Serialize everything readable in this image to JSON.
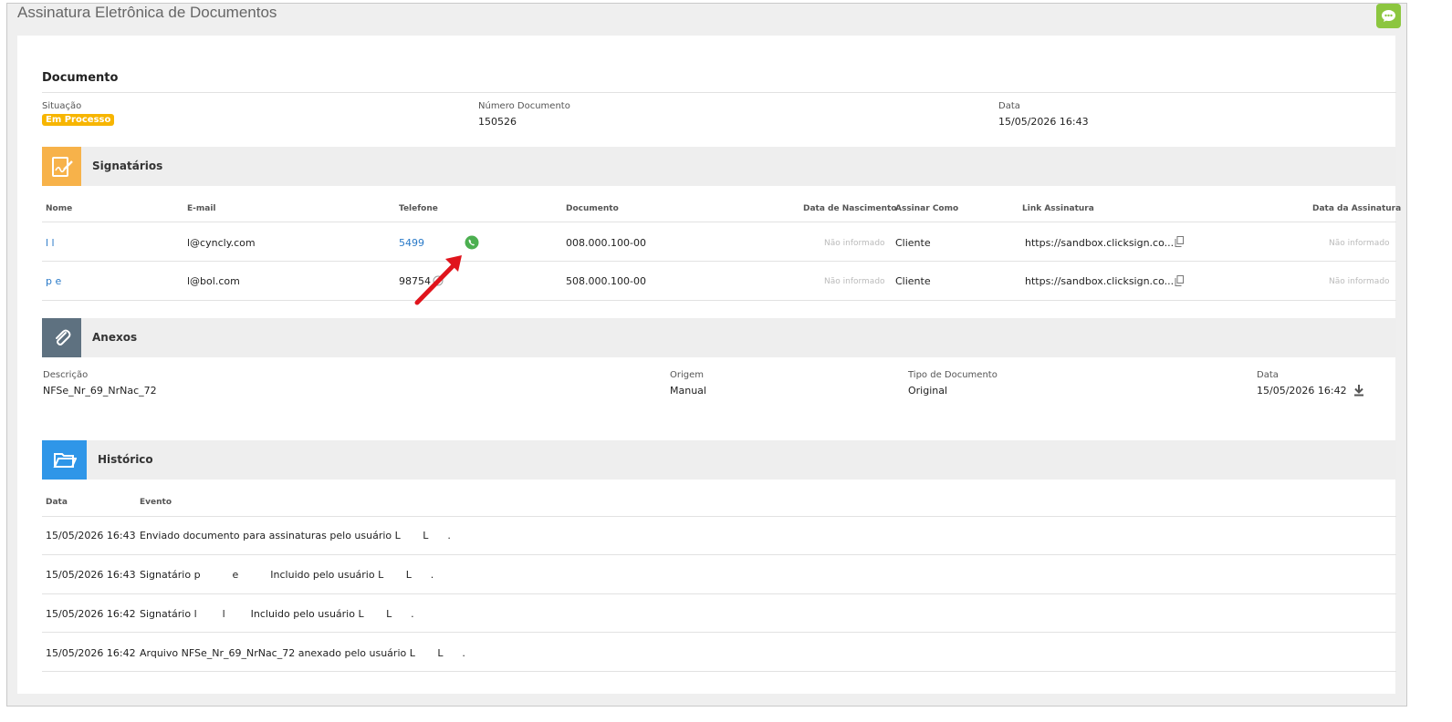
{
  "header": {
    "title": "Assinatura Eletrônica de Documentos",
    "chat_icon": "chat-bubble-icon"
  },
  "documento": {
    "title": "Documento",
    "situacao_label": "Situação",
    "situacao_value": "Em Processo",
    "numero_label": "Número Documento",
    "numero_value": "150526",
    "data_label": "Data",
    "data_value": "15/05/2026 16:43"
  },
  "signatarios": {
    "title": "Signatários",
    "columns": [
      "Nome",
      "E-mail",
      "Telefone",
      "Documento",
      "Data de Nascimento",
      "Assinar Como",
      "Link Assinatura",
      "Data da Assinatura"
    ],
    "rows": [
      {
        "nome": "l        l",
        "email": "l@cyncly.com",
        "telefone": "5499",
        "documento": "008.000.100-00",
        "nascimento": "Não informado",
        "assinar": "Cliente",
        "link": "https://sandbox.clicksign.co...",
        "data_assinatura": "Não informado"
      },
      {
        "nome": "p        e",
        "email": "l@bol.com",
        "telefone": "98754",
        "documento": "508.000.100-00",
        "nascimento": "Não informado",
        "assinar": "Cliente",
        "link": "https://sandbox.clicksign.co...",
        "data_assinatura": "Não informado"
      }
    ]
  },
  "anexos": {
    "title": "Anexos",
    "descricao_label": "Descrição",
    "descricao_value": "NFSe_Nr_69_NrNac_72",
    "origem_label": "Origem",
    "origem_value": "Manual",
    "tipo_label": "Tipo de Documento",
    "tipo_value": "Original",
    "data_label": "Data",
    "data_value": "15/05/2026 16:42"
  },
  "historico": {
    "title": "Histórico",
    "columns": [
      "Data",
      "Evento"
    ],
    "rows": [
      {
        "data": "15/05/2026 16:43",
        "evento": "Enviado documento para assinaturas pelo usuário L       L      ."
      },
      {
        "data": "15/05/2026 16:43",
        "evento": "Signatário p          e          Incluido pelo usuário L       L      ."
      },
      {
        "data": "15/05/2026 16:42",
        "evento": "Signatário l        l        Incluido pelo usuário L       L      ."
      },
      {
        "data": "15/05/2026 16:42",
        "evento": "Arquivo NFSe_Nr_69_NrNac_72 anexado pelo usuário L       L      ."
      }
    ]
  },
  "colors": {
    "accent_orange": "#f7b24a",
    "anexos_gray": "#5e7180",
    "historico_blue": "#2f96e8",
    "whatsapp": "#4caf50",
    "arrow_red": "#e0141c"
  }
}
